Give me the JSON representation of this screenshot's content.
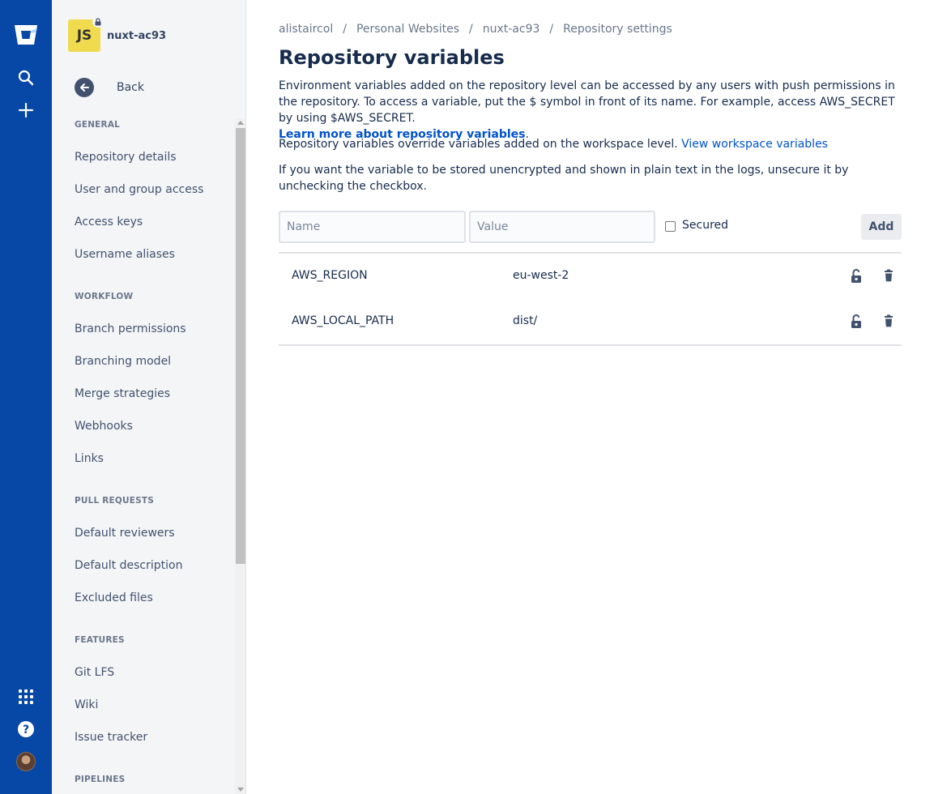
{
  "global_nav": {
    "icons": [
      "bitbucket-logo",
      "search-icon",
      "plus-icon",
      "app-switcher-icon",
      "help-icon",
      "user-avatar"
    ]
  },
  "sidebar": {
    "repo_name": "nuxt-ac93",
    "repo_avatar_text": "JS",
    "back_label": "Back",
    "sections": [
      {
        "title": "GENERAL",
        "items": [
          "Repository details",
          "User and group access",
          "Access keys",
          "Username aliases"
        ]
      },
      {
        "title": "WORKFLOW",
        "items": [
          "Branch permissions",
          "Branching model",
          "Merge strategies",
          "Webhooks",
          "Links"
        ]
      },
      {
        "title": "PULL REQUESTS",
        "items": [
          "Default reviewers",
          "Default description",
          "Excluded files"
        ]
      },
      {
        "title": "FEATURES",
        "items": [
          "Git LFS",
          "Wiki",
          "Issue tracker"
        ]
      },
      {
        "title": "PIPELINES",
        "items": []
      }
    ]
  },
  "breadcrumbs": [
    "alistaircol",
    "Personal Websites",
    "nuxt-ac93",
    "Repository settings"
  ],
  "breadcrumb_separator": "/",
  "page_title": "Repository variables",
  "intro": {
    "line1": "Environment variables added on the repository level can be accessed by any users with push permissions in the repository. To access a variable, put the $ symbol in front of its name. For example, access AWS_SECRET by using $AWS_SECRET.",
    "learn_more_link": "Learn more about repository variables",
    "learn_more_suffix": ".",
    "line2": "Repository variables override variables added on the workspace level.",
    "workspace_link": "View workspace variables",
    "line3": "If you want the variable to be stored unencrypted and shown in plain text in the logs, unsecure it by unchecking the checkbox."
  },
  "form": {
    "name_placeholder": "Name",
    "value_placeholder": "Value",
    "secured_label": "Secured",
    "secured_checked": false,
    "add_label": "Add"
  },
  "variables": [
    {
      "name": "AWS_REGION",
      "value": "eu-west-2",
      "secured": false
    },
    {
      "name": "AWS_LOCAL_PATH",
      "value": "dist/",
      "secured": false
    }
  ],
  "colors": {
    "nav_bg": "#0747a6",
    "link": "#0052cc",
    "text": "#172b4d",
    "sidebar_bg": "#f4f5f7",
    "js_badge": "#f0db4f"
  }
}
